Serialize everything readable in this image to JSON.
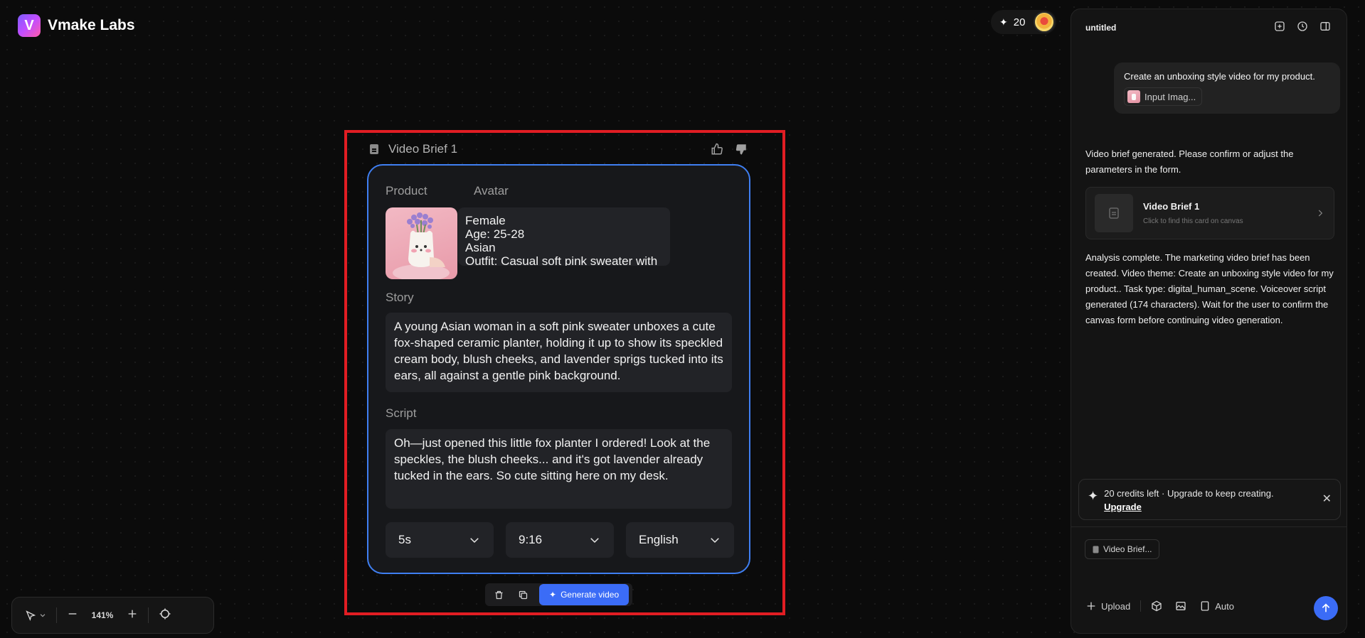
{
  "app": {
    "name": "Vmake Labs"
  },
  "credits": {
    "count": "20"
  },
  "canvas": {
    "card": {
      "title": "Video Brief 1",
      "product_label": "Product",
      "avatar_label": "Avatar",
      "avatar_lines": [
        "Female",
        "Age: 25-28",
        "Asian",
        "Outfit: Casual soft pink sweater with light"
      ],
      "story_label": "Story",
      "story_text": "A young Asian woman in a soft pink sweater unboxes a cute fox-shaped ceramic planter, holding it up to show its speckled cream body, blush cheeks, and lavender sprigs tucked into its ears, all against a gentle pink background.",
      "script_label": "Script",
      "script_text": "Oh—just opened this little fox planter I ordered! Look at the speckles, the blush cheeks... and it's got lavender already tucked in the ears. So cute sitting here on my desk.",
      "duration": "5s",
      "ratio": "9:16",
      "language": "English"
    },
    "actions": {
      "generate_label": "Generate video"
    },
    "zoom": {
      "value": "141%"
    }
  },
  "panel": {
    "title": "untitled",
    "user_message": "Create an unboxing style video for my product.",
    "input_chip": "Input Imag...",
    "msg1": "Video brief generated. Please confirm or adjust the parameters in the form.",
    "brief_ref": {
      "title": "Video Brief 1",
      "subtitle": "Click to find this card on canvas"
    },
    "msg2": "Analysis complete. The marketing video brief has been created. Video theme: Create an unboxing style video for my product.. Task type: digital_human_scene. Voiceover script generated (174 characters). Wait for the user to confirm the canvas form before continuing video generation.",
    "upgrade": {
      "text": "20 credits left · Upgrade to keep creating.",
      "link": "Upgrade"
    },
    "ref_chip": "Video Brief...",
    "tools": {
      "upload": "Upload",
      "auto": "Auto"
    }
  },
  "colors": {
    "accent": "#3b6cf6",
    "selection": "#e11d23",
    "card_border": "#3f7ff2"
  }
}
